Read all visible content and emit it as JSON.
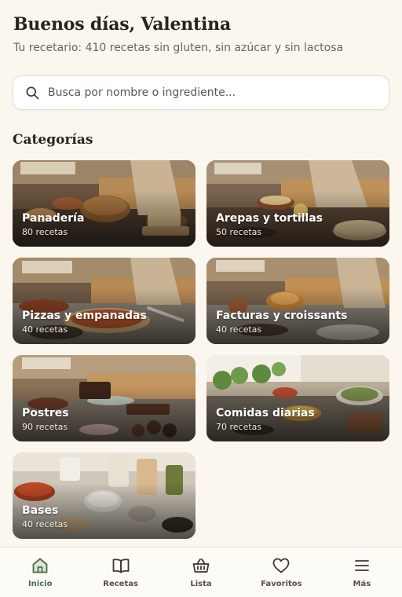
{
  "header": {
    "greeting": "Buenos días, Valentina",
    "subtitle": "Tu recetario: 410 recetas sin gluten, sin azúcar y sin lactosa"
  },
  "search": {
    "placeholder": "Busca por nombre o ingrediente...",
    "value": ""
  },
  "categories": {
    "title": "Categorías",
    "items": [
      {
        "name": "Panadería",
        "count": "80 recetas",
        "scene": "bread"
      },
      {
        "name": "Arepas y tortillas",
        "count": "50 recetas",
        "scene": "tortilla"
      },
      {
        "name": "Pizzas y empanadas",
        "count": "40 recetas",
        "scene": "pizza"
      },
      {
        "name": "Facturas y croissants",
        "count": "40 recetas",
        "scene": "croissant"
      },
      {
        "name": "Postres",
        "count": "90 recetas",
        "scene": "dessert"
      },
      {
        "name": "Comidas diarias",
        "count": "70 recetas",
        "scene": "meals"
      },
      {
        "name": "Bases",
        "count": "40 recetas",
        "scene": "pantry"
      }
    ]
  },
  "tabbar": {
    "active": "Inicio",
    "items": [
      {
        "label": "Inicio",
        "icon": "home-icon"
      },
      {
        "label": "Recetas",
        "icon": "book-icon"
      },
      {
        "label": "Lista",
        "icon": "basket-icon"
      },
      {
        "label": "Favoritos",
        "icon": "heart-icon"
      },
      {
        "label": "Más",
        "icon": "menu-icon"
      }
    ]
  },
  "colors": {
    "background": "#fbf7ef",
    "accent": "#4a6b4a",
    "text": "#2a231d",
    "muted": "#6b625a"
  }
}
